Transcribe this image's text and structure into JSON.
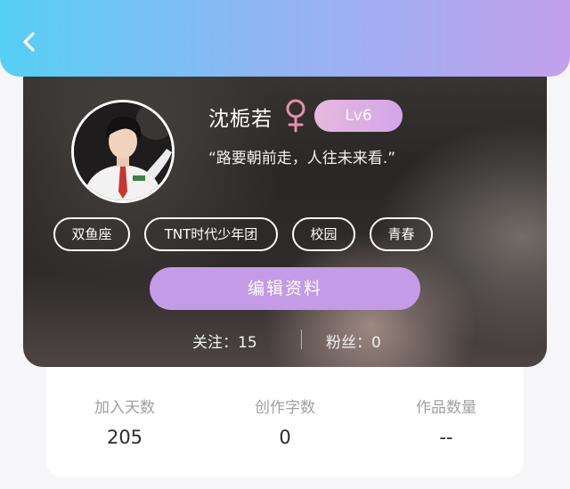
{
  "header": {
    "back_icon": "chevron-left-icon",
    "gradient_colors": [
      "#56cff5",
      "#c3a0ee"
    ]
  },
  "profile": {
    "avatar_icon": "user-avatar",
    "username": "沈栀若",
    "gender_icon": "female-symbol-icon",
    "gender_color": "#e98fb0",
    "level": "Lv6",
    "signature": "“路要朝前走，人往未来看.”",
    "tags": [
      "双鱼座",
      "TNT时代少年团",
      "校园",
      "青春"
    ],
    "edit_button_label": "编辑资料",
    "following_label": "关注：15",
    "fans_label": "粉丝：0"
  },
  "stats": [
    {
      "label": "加入天数",
      "value": "205"
    },
    {
      "label": "创作字数",
      "value": "0"
    },
    {
      "label": "作品数量",
      "value": "--"
    }
  ],
  "colors": {
    "accent_purple": "#c49be6",
    "level_badge": "#dcaee4"
  }
}
